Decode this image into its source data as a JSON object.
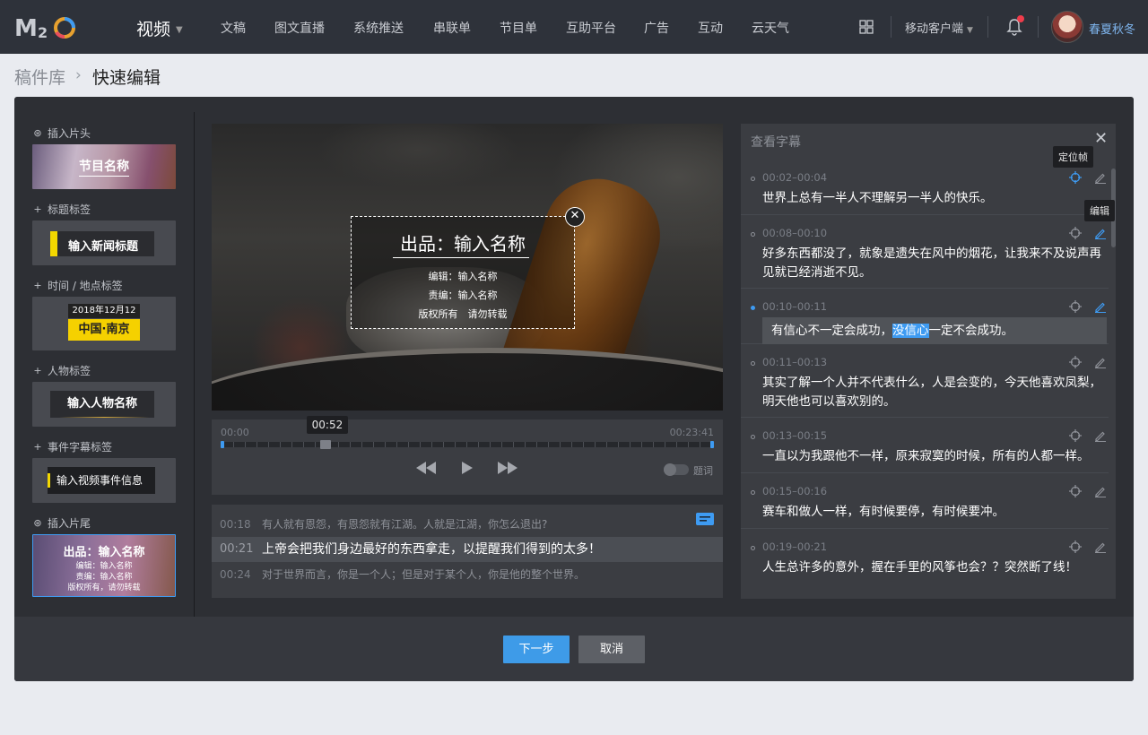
{
  "nav": {
    "section": "视频",
    "items": [
      "文稿",
      "图文直播",
      "系统推送",
      "串联单",
      "节目单",
      "互助平台",
      "广告",
      "互动",
      "云天气"
    ],
    "mobile": "移动客户端",
    "username": "春夏秋冬"
  },
  "breadcrumb": {
    "parent": "稿件库",
    "current": "快速编辑"
  },
  "sidebar": {
    "opening_label": "插入片头",
    "opening_title": "节目名称",
    "title_tag_label": "标题标签",
    "title_tag_text": "输入新闻标题",
    "time_place_label": "时间 / 地点标签",
    "time_place_date": "2018年12月12日",
    "time_place_place": "中国·南京",
    "person_label": "人物标签",
    "person_text": "输入人物名称",
    "event_label": "事件字幕标签",
    "event_text": "输入视频事件信息",
    "ending_label": "插入片尾",
    "ending_title": "出品：输入名称",
    "ending_editor": "编辑：输入名称",
    "ending_chief": "责编：输入名称",
    "ending_rights": "版权所有，请勿转载"
  },
  "overlay": {
    "title": "出品：输入名称",
    "editor": "编辑：输入名称",
    "chief": "责编：输入名称",
    "rights": "版权所有　请勿转载"
  },
  "player": {
    "start": "00:00",
    "end": "00:23:41",
    "current": "00:52",
    "progress_fraction": 0.21,
    "toggle_label": "题词"
  },
  "transcript": [
    {
      "time": "00:18",
      "text": "有人就有恩怨，有恩怨就有江湖。人就是江湖，你怎么退出?"
    },
    {
      "time": "00:21",
      "text": "上帝会把我们身边最好的东西拿走，以提醒我们得到的太多！"
    },
    {
      "time": "00:24",
      "text": "对于世界而言，你是一个人；但是对于某个人，你是他的整个世界。"
    }
  ],
  "subtitles": {
    "heading": "查看字幕",
    "tip_locate": "定位帧",
    "tip_edit": "编辑",
    "items": [
      {
        "time": "00:02–00:04",
        "text": "世界上总有一半人不理解另一半人的快乐。"
      },
      {
        "time": "00:08–00:10",
        "text": "好多东西都没了，就象是遗失在风中的烟花，让我来不及说声再见就已经消逝不见。"
      },
      {
        "time": "00:10–00:11",
        "text_before": "有信心不一定会成功，",
        "text_highlight": "没信心",
        "text_after": "一定不会成功。"
      },
      {
        "time": "00:11–00:13",
        "text": "其实了解一个人并不代表什么，人是会变的，今天他喜欢凤梨，明天他也可以喜欢别的。"
      },
      {
        "time": "00:13–00:15",
        "text": "一直以为我跟他不一样，原来寂寞的时候，所有的人都一样。"
      },
      {
        "time": "00:15–00:16",
        "text": "赛车和做人一样，有时候要停，有时候要冲。"
      },
      {
        "time": "00:19–00:21",
        "text": "人生总许多的意外，握在手里的风筝也会？？突然断了线！"
      }
    ]
  },
  "buttons": {
    "next": "下一步",
    "cancel": "取消"
  },
  "colors": {
    "accent": "#3e9be8",
    "panel": "#2d2f34",
    "topbar": "#2e323a",
    "highlight_yellow": "#f3d700"
  }
}
